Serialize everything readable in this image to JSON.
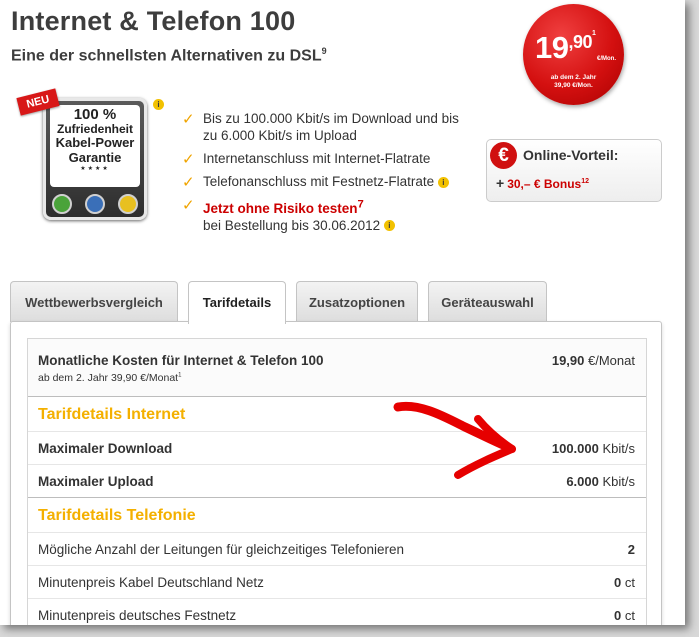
{
  "header": {
    "title": "Internet & Telefon 100",
    "subtitle": "Eine der schnellsten Alternativen zu DSL",
    "subtitle_footnote": "9"
  },
  "price": {
    "main": "19",
    "cents": ",90",
    "footnote": "1",
    "unit": "€/Mon.",
    "note_line1": "ab dem 2. Jahr",
    "note_line2": "39,90 €/Mon."
  },
  "badge": {
    "ribbon": "NEU",
    "line1": "100 %",
    "line2": "Zufriedenheit",
    "line3": "Kabel-Power",
    "line4": "Garantie",
    "stars": "★★★★",
    "info": "i"
  },
  "features": [
    {
      "text": "Bis zu 100.000 Kbit/s im Download und bis zu 6.000 Kbit/s im Upload"
    },
    {
      "text": "Internetanschluss mit Internet-Flatrate"
    },
    {
      "text": "Telefonanschluss mit Festnetz-Flatrate"
    },
    {
      "promo": "Jetzt ohne Risiko testen",
      "promo_footnote": "7",
      "text": "bei Bestellung bis 30.06.2012"
    }
  ],
  "online": {
    "title": "Online-Vorteil:",
    "plus": "+",
    "bonus": "30,– € Bonus",
    "bonus_footnote": "12",
    "euro": "€"
  },
  "tabs": [
    {
      "label": "Wettbewerbsvergleich"
    },
    {
      "label": "Tarifdetails"
    },
    {
      "label": "Zusatzoptionen"
    },
    {
      "label": "Geräteauswahl"
    }
  ],
  "costs": {
    "title": "Monatliche Kosten für Internet & Telefon 100",
    "sub": "ab dem 2. Jahr 39,90 €/Monat",
    "sub_footnote": "1",
    "value": "19,90",
    "unit": "€/Monat"
  },
  "internet": {
    "heading": "Tarifdetails Internet",
    "rows": [
      {
        "label": "Maximaler Download",
        "value": "100.000",
        "unit": "Kbit/s"
      },
      {
        "label": "Maximaler Upload",
        "value": "6.000",
        "unit": "Kbit/s"
      }
    ]
  },
  "telefonie": {
    "heading": "Tarifdetails Telefonie",
    "rows": [
      {
        "label": "Mögliche Anzahl der Leitungen für gleichzeitiges Telefonieren",
        "value": "2",
        "unit": ""
      },
      {
        "label": "Minutenpreis Kabel Deutschland Netz",
        "value": "0",
        "unit": "ct"
      },
      {
        "label": "Minutenpreis deutsches Festnetz",
        "value": "0",
        "unit": "ct"
      }
    ]
  },
  "colors": {
    "accent_red": "#cc0000",
    "accent_yellow": "#f4b000",
    "check_orange": "#f0a400",
    "annotation_red": "#e60000"
  }
}
